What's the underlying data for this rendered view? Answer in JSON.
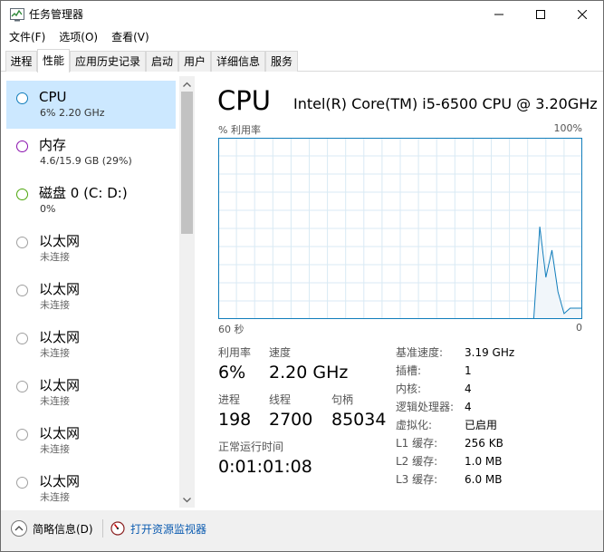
{
  "window": {
    "title": "任务管理器",
    "controls": [
      "minimize-icon",
      "maximize-icon",
      "close-icon"
    ]
  },
  "menu": [
    {
      "label": "文件(F)"
    },
    {
      "label": "选项(O)"
    },
    {
      "label": "查看(V)"
    }
  ],
  "tabs": [
    {
      "label": "进程"
    },
    {
      "label": "性能"
    },
    {
      "label": "应用历史记录"
    },
    {
      "label": "启动"
    },
    {
      "label": "用户"
    },
    {
      "label": "详细信息"
    },
    {
      "label": "服务"
    }
  ],
  "active_tab": "性能",
  "sidebar": {
    "items": [
      {
        "name": "CPU",
        "detail": "6%  2.20 GHz",
        "ring_color": "#117dbb",
        "selected": true
      },
      {
        "name": "内存",
        "detail": "4.6/15.9 GB (29%)",
        "ring_color": "#8b12ae",
        "selected": false
      },
      {
        "name": "磁盘 0 (C: D:)",
        "detail": "0%",
        "ring_color": "#4da60c",
        "selected": false
      },
      {
        "name": "以太网",
        "detail": "未连接",
        "ring_color": "#a0a0a0",
        "selected": false
      },
      {
        "name": "以太网",
        "detail": "未连接",
        "ring_color": "#a0a0a0",
        "selected": false
      },
      {
        "name": "以太网",
        "detail": "未连接",
        "ring_color": "#a0a0a0",
        "selected": false
      },
      {
        "name": "以太网",
        "detail": "未连接",
        "ring_color": "#a0a0a0",
        "selected": false
      },
      {
        "name": "以太网",
        "detail": "未连接",
        "ring_color": "#a0a0a0",
        "selected": false
      },
      {
        "name": "以太网",
        "detail": "未连接",
        "ring_color": "#a0a0a0",
        "selected": false
      }
    ]
  },
  "cpu": {
    "title": "CPU",
    "model": "Intel(R) Core(TM) i5-6500 CPU @ 3.20GHz",
    "graph": {
      "y_label": "% 利用率",
      "y_max": "100%",
      "x_left": "60 秒",
      "x_right": "0",
      "line_color": "#117dbb",
      "fill_color": "#f1f6fa",
      "grid_color": "#d9eaf4",
      "utilization_history_pct": [
        0,
        0,
        0,
        0,
        0,
        0,
        0,
        0,
        0,
        0,
        0,
        0,
        0,
        0,
        0,
        0,
        0,
        0,
        0,
        0,
        0,
        0,
        0,
        0,
        0,
        0,
        0,
        0,
        0,
        0,
        0,
        0,
        0,
        0,
        0,
        0,
        0,
        0,
        0,
        0,
        0,
        0,
        0,
        0,
        0,
        0,
        0,
        0,
        0,
        0,
        0,
        0,
        0,
        51,
        23,
        38,
        15,
        3,
        6,
        6,
        6
      ]
    },
    "stats": {
      "utilization_label": "利用率",
      "utilization": "6%",
      "speed_label": "速度",
      "speed": "2.20 GHz",
      "processes_label": "进程",
      "processes": "198",
      "threads_label": "线程",
      "threads": "2700",
      "handles_label": "句柄",
      "handles": "85034",
      "uptime_label": "正常运行时间",
      "uptime": "0:01:01:08"
    },
    "specs": [
      {
        "label": "基准速度:",
        "value": "3.19 GHz"
      },
      {
        "label": "插槽:",
        "value": "1"
      },
      {
        "label": "内核:",
        "value": "4"
      },
      {
        "label": "逻辑处理器:",
        "value": "4"
      },
      {
        "label": "虚拟化:",
        "value": "已启用"
      },
      {
        "label": "L1 缓存:",
        "value": "256 KB"
      },
      {
        "label": "L2 缓存:",
        "value": "1.0 MB"
      },
      {
        "label": "L3 缓存:",
        "value": "6.0 MB"
      }
    ]
  },
  "footer": {
    "fewer_details": "简略信息(D)",
    "open_monitor": "打开资源监视器"
  }
}
